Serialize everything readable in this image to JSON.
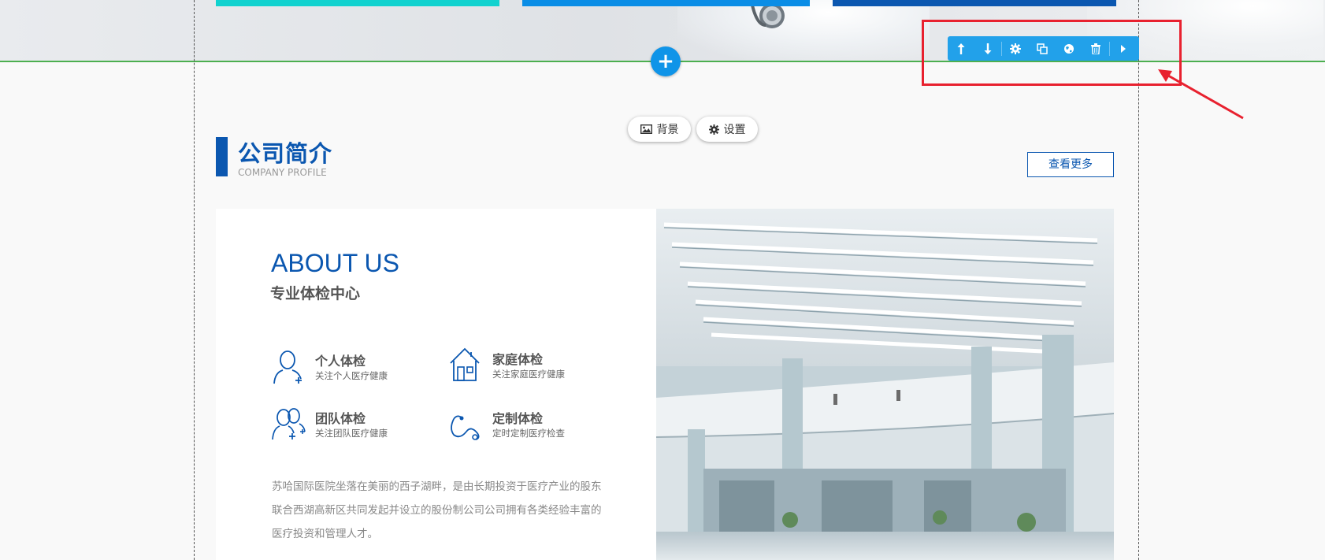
{
  "toolbar": {
    "icons": [
      "arrow-up-icon",
      "arrow-down-icon",
      "gear-icon",
      "copy-icon",
      "globe-icon",
      "trash-icon",
      "caret-right-icon"
    ]
  },
  "pills": {
    "background_label": "背景",
    "settings_label": "设置"
  },
  "section": {
    "title": "公司简介",
    "subtitle": "COMPANY PROFILE",
    "more_label": "查看更多"
  },
  "about": {
    "heading_en": "ABOUT US",
    "heading_cn": "专业体检中心",
    "features": [
      {
        "title": "个人体检",
        "desc": "关注个人医疗健康",
        "icon": "person-icon"
      },
      {
        "title": "家庭体检",
        "desc": "关注家庭医疗健康",
        "icon": "house-icon"
      },
      {
        "title": "团队体检",
        "desc": "关注团队医疗健康",
        "icon": "team-icon"
      },
      {
        "title": "定制体检",
        "desc": "定时定制医疗检查",
        "icon": "stethoscope-icon"
      }
    ],
    "description": "苏哈国际医院坐落在美丽的西子湖畔，是由长期投资于医疗产业的股东联合西湖高新区共同发起并设立的股份制公司公司拥有各类经验丰富的医疗投资和管理人才。"
  },
  "colors": {
    "accent": "#0b57b0",
    "toolbar": "#22a1ea",
    "highlight": "#e8212f",
    "divider": "#4caf50"
  }
}
